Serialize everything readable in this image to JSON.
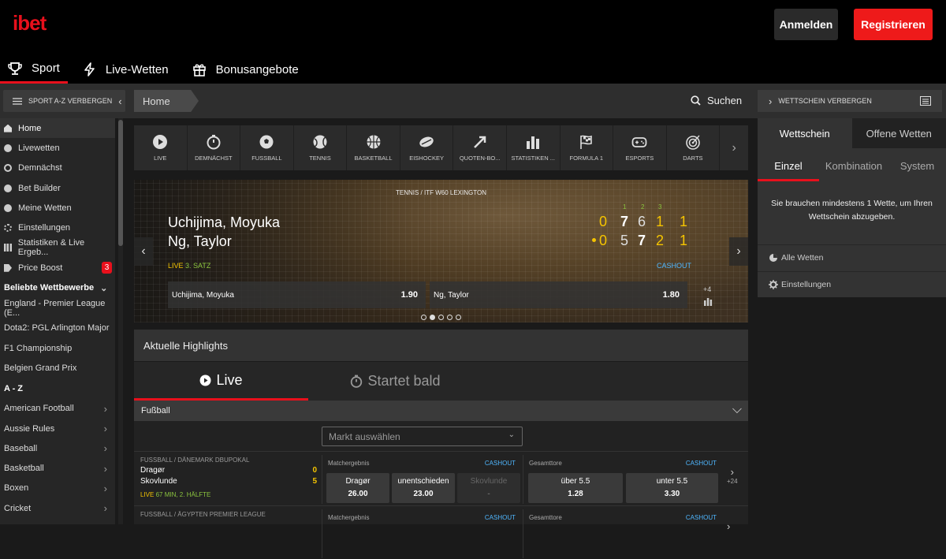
{
  "header": {
    "logo": "ibet",
    "login": "Anmelden",
    "register": "Registrieren",
    "nav": [
      {
        "label": "Sport",
        "icon": "trophy-icon"
      },
      {
        "label": "Live-Wetten",
        "icon": "lightning-icon"
      },
      {
        "label": "Bonusangebote",
        "icon": "gift-icon"
      }
    ]
  },
  "subbar": {
    "sport_az": "SPORT A-Z VERBERGEN",
    "breadcrumb": "Home",
    "search": "Suchen",
    "wettschein_hide": "WETTSCHEIN VERBERGEN"
  },
  "sidebar": {
    "items": [
      {
        "label": "Home"
      },
      {
        "label": "Livewetten"
      },
      {
        "label": "Demnächst"
      },
      {
        "label": "Bet Builder"
      },
      {
        "label": "Meine Wetten"
      },
      {
        "label": "Einstellungen"
      },
      {
        "label": "Statistiken & Live Ergeb..."
      },
      {
        "label": "Price Boost",
        "badge": "3"
      }
    ],
    "popular_title": "Beliebte Wettbewerbe",
    "popular": [
      "England - Premier League (E...",
      "Dota2: PGL Arlington Major",
      "F1 Championship",
      "Belgien Grand Prix"
    ],
    "az_title": "A - Z",
    "az": [
      "American Football",
      "Aussie Rules",
      "Baseball",
      "Basketball",
      "Boxen",
      "Cricket"
    ]
  },
  "sports": [
    "LIVE",
    "DEMNÄCHST",
    "FUSSBALL",
    "TENNIS",
    "BASKETBALL",
    "EISHOCKEY",
    "QUOTEN-BO...",
    "STATISTIKEN ...",
    "FORMULA 1",
    "ESPORTS",
    "DARTS"
  ],
  "hero": {
    "league": "TENNIS / ITF W60 LEXINGTON",
    "player1": "Uchijima, Moyuka",
    "player2": "Ng, Taylor",
    "live_label": "LIVE",
    "set_label": "3. SATZ",
    "cashout": "CASHOUT",
    "set_headers": [
      "1",
      "2",
      "3"
    ],
    "score1": [
      "0",
      "7",
      "6",
      "1",
      "1"
    ],
    "score2": [
      "0",
      "5",
      "7",
      "2",
      "1"
    ],
    "odd1_name": "Uchijima, Moyuka",
    "odd1_value": "1.90",
    "odd2_name": "Ng, Taylor",
    "odd2_value": "1.80",
    "more": "+4",
    "slides": 5,
    "active_slide": 2
  },
  "highlights": {
    "title": "Aktuelle Highlights",
    "tab_live": "Live",
    "tab_soon": "Startet bald",
    "section": "Fußball",
    "market_placeholder": "Markt auswählen"
  },
  "events": [
    {
      "league": "FUSSBALL / DÄNEMARK DBUPOKAL",
      "team1": "Dragør",
      "score1": "0",
      "team2": "Skovlunde",
      "score2": "5",
      "live": "LIVE",
      "time": "67 MIN, 2. HÄLFTE",
      "m1_label": "Matchergebnis",
      "m1_cash": "CASHOUT",
      "m1": [
        {
          "n": "Dragør",
          "o": "26.00"
        },
        {
          "n": "unentschieden",
          "o": "23.00"
        },
        {
          "n": "Skovlunde",
          "o": "-"
        }
      ],
      "m2_label": "Gesamttore",
      "m2_cash": "CASHOUT",
      "m2": [
        {
          "n": "über 5.5",
          "o": "1.28"
        },
        {
          "n": "unter 5.5",
          "o": "3.30"
        }
      ],
      "more": "+24"
    },
    {
      "league": "FUSSBALL / ÄGYPTEN PREMIER LEAGUE",
      "m1_label": "Matchergebnis",
      "m1_cash": "CASHOUT",
      "m2_label": "Gesamttore",
      "m2_cash": "CASHOUT"
    }
  ],
  "betslip": {
    "tabs": [
      "Wettschein",
      "Offene Wetten"
    ],
    "subtabs": [
      "Einzel",
      "Kombination",
      "System"
    ],
    "message": "Sie brauchen mindestens 1 Wette, um Ihren Wettschein abzugeben.",
    "all_bets": "Alle Wetten",
    "settings": "Einstellungen"
  },
  "colors": {
    "accent": "#e8101c",
    "cashout": "#4fb7ff",
    "score": "#f5c400",
    "live_green": "#8cc63f"
  }
}
